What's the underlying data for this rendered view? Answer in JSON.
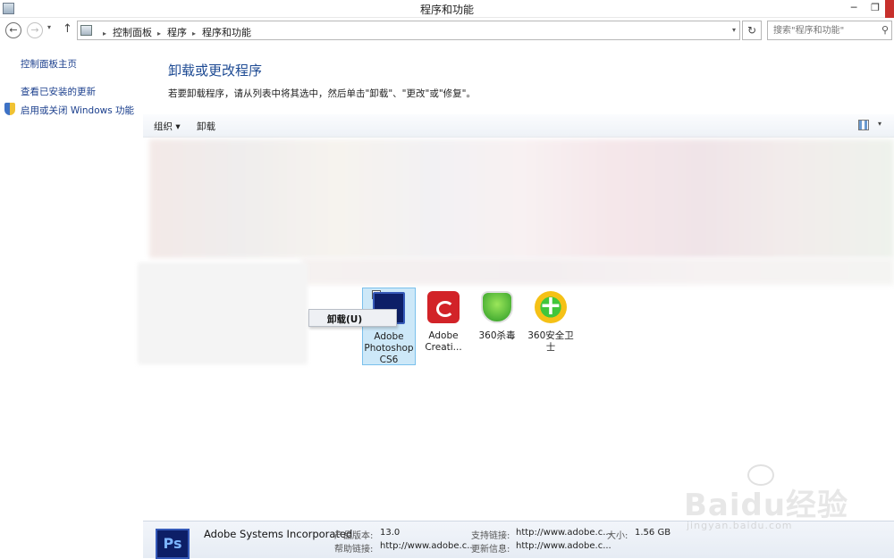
{
  "window": {
    "title": "程序和功能",
    "min_glyph": "─",
    "max_glyph": "❐"
  },
  "address_bar": {
    "back_glyph": "←",
    "forward_glyph": "→",
    "recent_glyph": "▾",
    "up_glyph": "↑",
    "separator": "▸",
    "breadcrumbs": [
      "控制面板",
      "程序",
      "程序和功能"
    ],
    "refresh_glyph": "↻",
    "search_placeholder": "搜索\"程序和功能\"",
    "search_glyph": "⚲"
  },
  "left_nav": {
    "items": [
      "控制面板主页",
      "查看已安装的更新",
      "启用或关闭 Windows 功能"
    ]
  },
  "main": {
    "heading": "卸载或更改程序",
    "description": "若要卸载程序，请从列表中将其选中，然后单击\"卸载\"、\"更改\"或\"修复\"。"
  },
  "toolbar": {
    "organize": "组织 ▾",
    "uninstall": "卸载",
    "view_dropdown": "▾"
  },
  "programs": [
    {
      "line1": "Adobe",
      "line2": "Photoshop",
      "line3": "CS6",
      "icon": "photoshop-icon",
      "checked": "✓"
    },
    {
      "line1": "Adobe",
      "line2": "Creati...",
      "icon": "creative-cloud-icon"
    },
    {
      "line1": "360杀毒",
      "icon": "360-antivirus-icon"
    },
    {
      "line1": "360安全卫士",
      "icon": "360-security-icon"
    }
  ],
  "context_menu": {
    "item": "卸载(U)"
  },
  "details": {
    "icon_text": "Ps",
    "publisher": "Adobe Systems Incorporated",
    "product_version_label": "产品版本:",
    "product_version": "13.0",
    "help_link_label": "帮助链接:",
    "help_link": "http://www.adobe.c...",
    "support_link_label": "支持链接:",
    "support_link": "http://www.adobe.c...",
    "update_info_label": "更新信息:",
    "update_info": "http://www.adobe.c...",
    "size_label": "大小:",
    "size": "1.56 GB"
  },
  "watermark": {
    "brand": "Baidu经验",
    "url": "jingyan.baidu.com"
  },
  "colors": {
    "link": "#1b3f8d",
    "heading": "#1d4a93",
    "selection_bg": "#cde8f8",
    "selection_border": "#7ac0ec",
    "close_button": "#c7302c"
  }
}
